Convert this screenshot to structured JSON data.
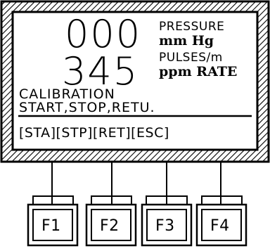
{
  "display": {
    "value_top": "000",
    "value_bottom": "345",
    "label_top_line1": "PRESSURE",
    "label_top_line2": "mm Hg",
    "label_bottom_line1": "PULSES/m",
    "label_bottom_line2": "ppm RATE",
    "message_line1": "CALIBRATION",
    "message_line2": "START,STOP,RETU.",
    "softkey_row": "[STA][STP][RET][ESC]"
  },
  "buttons": [
    {
      "label": "F1"
    },
    {
      "label": "F2"
    },
    {
      "label": "F3"
    },
    {
      "label": "F4"
    }
  ]
}
